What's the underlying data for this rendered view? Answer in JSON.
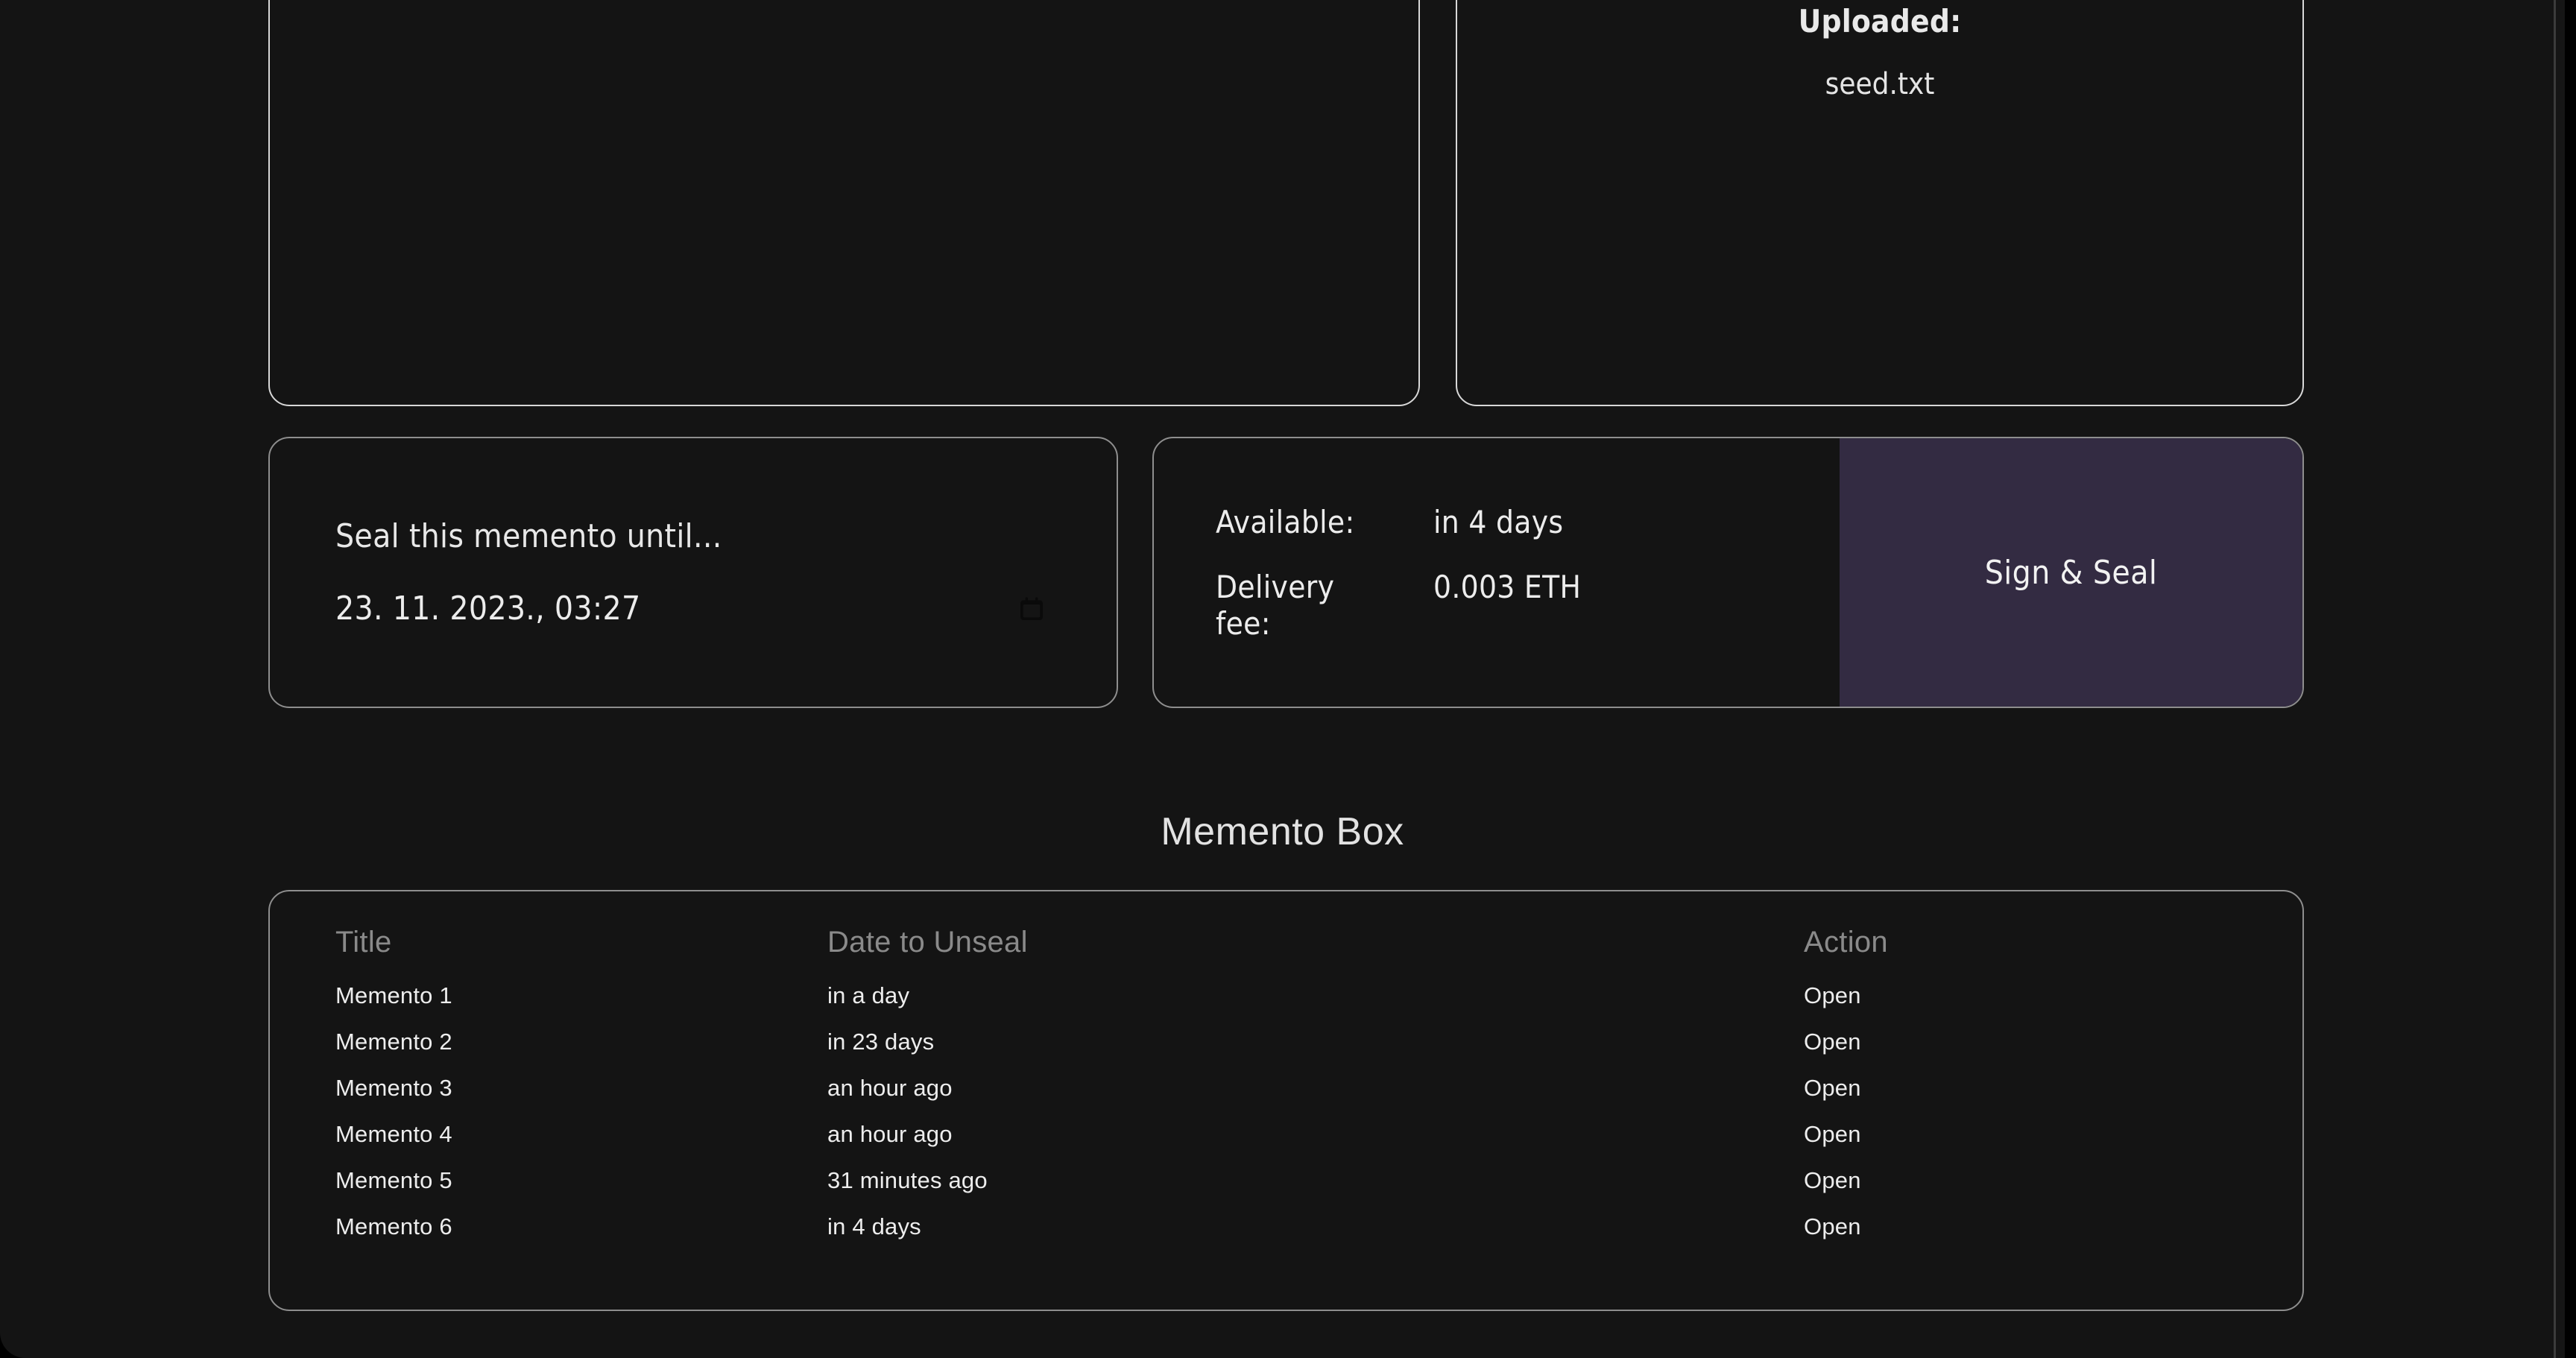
{
  "upload_card": {
    "label": "Uploaded:",
    "filename": "seed.txt"
  },
  "date_card": {
    "label": "Seal this memento until...",
    "datetime_value": "23. 11. 2023., 03:27",
    "calendar_icon": "calendar-icon"
  },
  "seal_card": {
    "available_label": "Available:",
    "available_value": "in 4 days",
    "fee_label": "Delivery fee:",
    "fee_value": "0.003 ETH",
    "button_label": "Sign & Seal",
    "button_color": "#332b42"
  },
  "memento_box": {
    "heading": "Memento Box",
    "columns": [
      "Title",
      "Date to Unseal",
      "Action"
    ],
    "rows": [
      {
        "title": "Memento 1",
        "date": "in a day",
        "action": "Open"
      },
      {
        "title": "Memento 2",
        "date": "in 23 days",
        "action": "Open"
      },
      {
        "title": "Memento 3",
        "date": "an hour ago",
        "action": "Open"
      },
      {
        "title": "Memento 4",
        "date": "an hour ago",
        "action": "Open"
      },
      {
        "title": "Memento 5",
        "date": "31 minutes ago",
        "action": "Open"
      },
      {
        "title": "Memento 6",
        "date": "in 4 days",
        "action": "Open"
      }
    ]
  }
}
